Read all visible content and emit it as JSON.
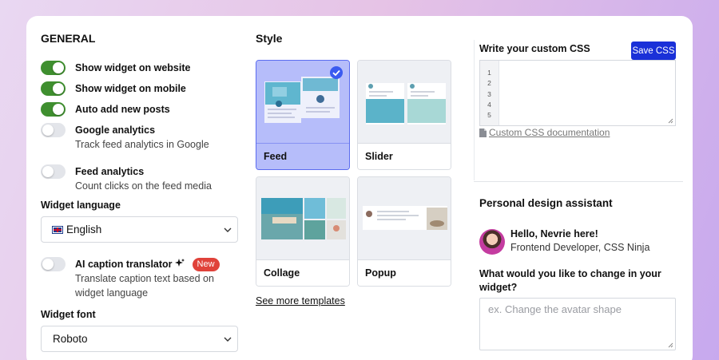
{
  "general": {
    "title": "GENERAL",
    "toggles": [
      {
        "label": "Show widget on website",
        "on": true
      },
      {
        "label": "Show widget on mobile",
        "on": true
      },
      {
        "label": "Auto add new posts",
        "on": true
      },
      {
        "label": "Google analytics",
        "desc": "Track feed analytics in Google",
        "on": false
      },
      {
        "label": "Feed analytics",
        "desc": "Count clicks on the feed media",
        "on": false
      }
    ],
    "language_label": "Widget language",
    "language_value": "English",
    "ai_label": "AI caption translator",
    "ai_badge": "New",
    "ai_desc_1": "Translate caption text based on",
    "ai_desc_2": "widget language",
    "font_label": "Widget font",
    "font_value": "Roboto"
  },
  "style": {
    "title": "Style",
    "templates": [
      {
        "label": "Feed",
        "selected": true
      },
      {
        "label": "Slider",
        "selected": false
      },
      {
        "label": "Collage",
        "selected": false
      },
      {
        "label": "Popup",
        "selected": false
      }
    ],
    "see_more": "See more templates"
  },
  "css_editor": {
    "title": "Write your custom CSS",
    "save_label": "Save CSS",
    "line_numbers": [
      "1",
      "2",
      "3",
      "4",
      "5"
    ],
    "doc_link": " Custom CSS documentation"
  },
  "assistant": {
    "title": "Personal design assistant",
    "greeting": "Hello, Nevrie here!",
    "role": "Frontend Developer, CSS Ninja",
    "question_1": "What would you like to change in your",
    "question_2": "widget?",
    "placeholder": "ex. Change the avatar shape"
  },
  "colors": {
    "accent": "#1a30d8",
    "toggle_on": "#3f8f2f",
    "selected_card": "#b6bdfa",
    "badge": "#e0423a"
  }
}
